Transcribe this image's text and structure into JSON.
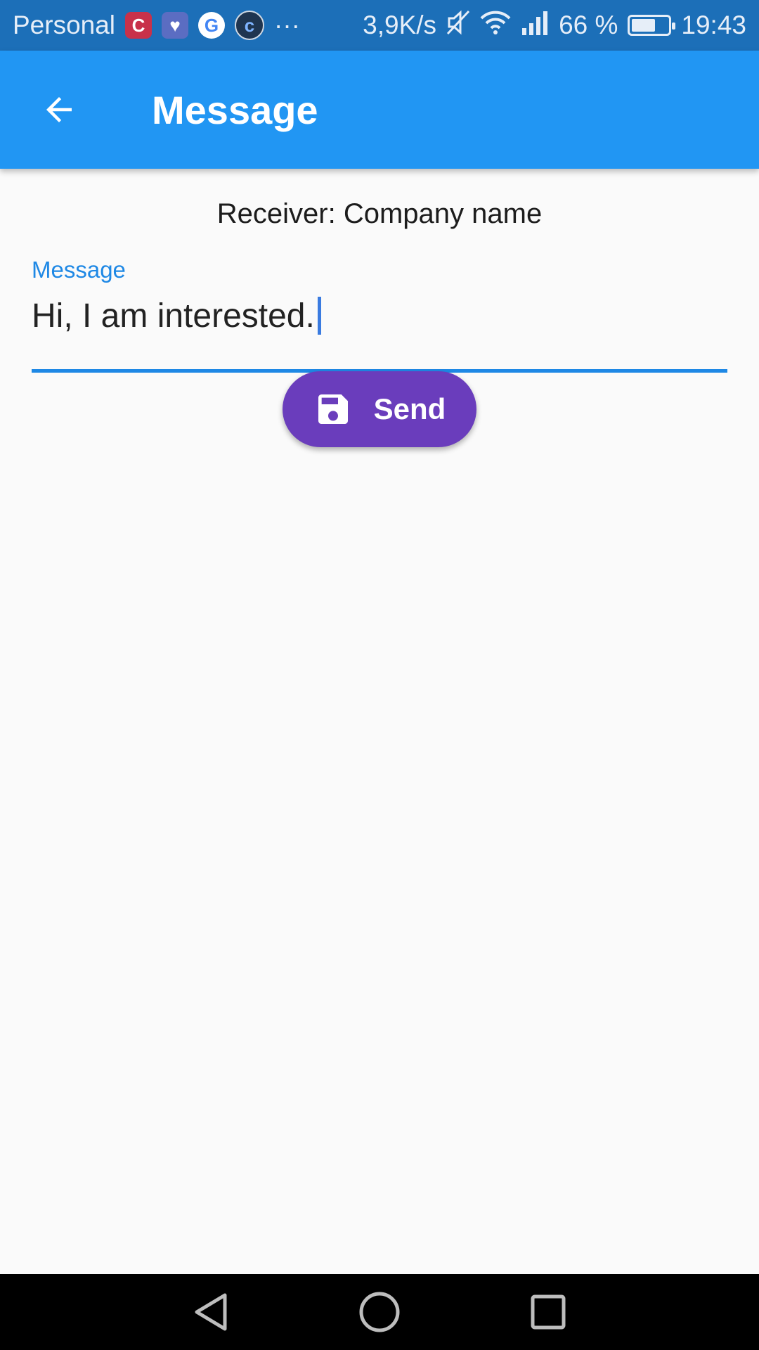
{
  "status_bar": {
    "carrier": "Personal",
    "more_indicator": "···",
    "network_speed": "3,9K/s",
    "battery_percent": "66 %",
    "battery_level": 0.66,
    "time": "19:43",
    "icons": [
      "c-app-icon",
      "health-icon",
      "google-icon",
      "c-circle-icon",
      "mute-icon",
      "wifi-icon",
      "signal-icon",
      "battery-icon"
    ]
  },
  "app_bar": {
    "title": "Message"
  },
  "receiver_text": "Receiver: Company name",
  "message_field": {
    "label": "Message",
    "value": "Hi, I am interested."
  },
  "send_button": {
    "label": "Send",
    "icon": "save-icon"
  },
  "colors": {
    "app_bar": "#2196f3",
    "status_bar": "#1c6fb8",
    "accent": "#1e88e5",
    "button": "#6a3dbc"
  }
}
